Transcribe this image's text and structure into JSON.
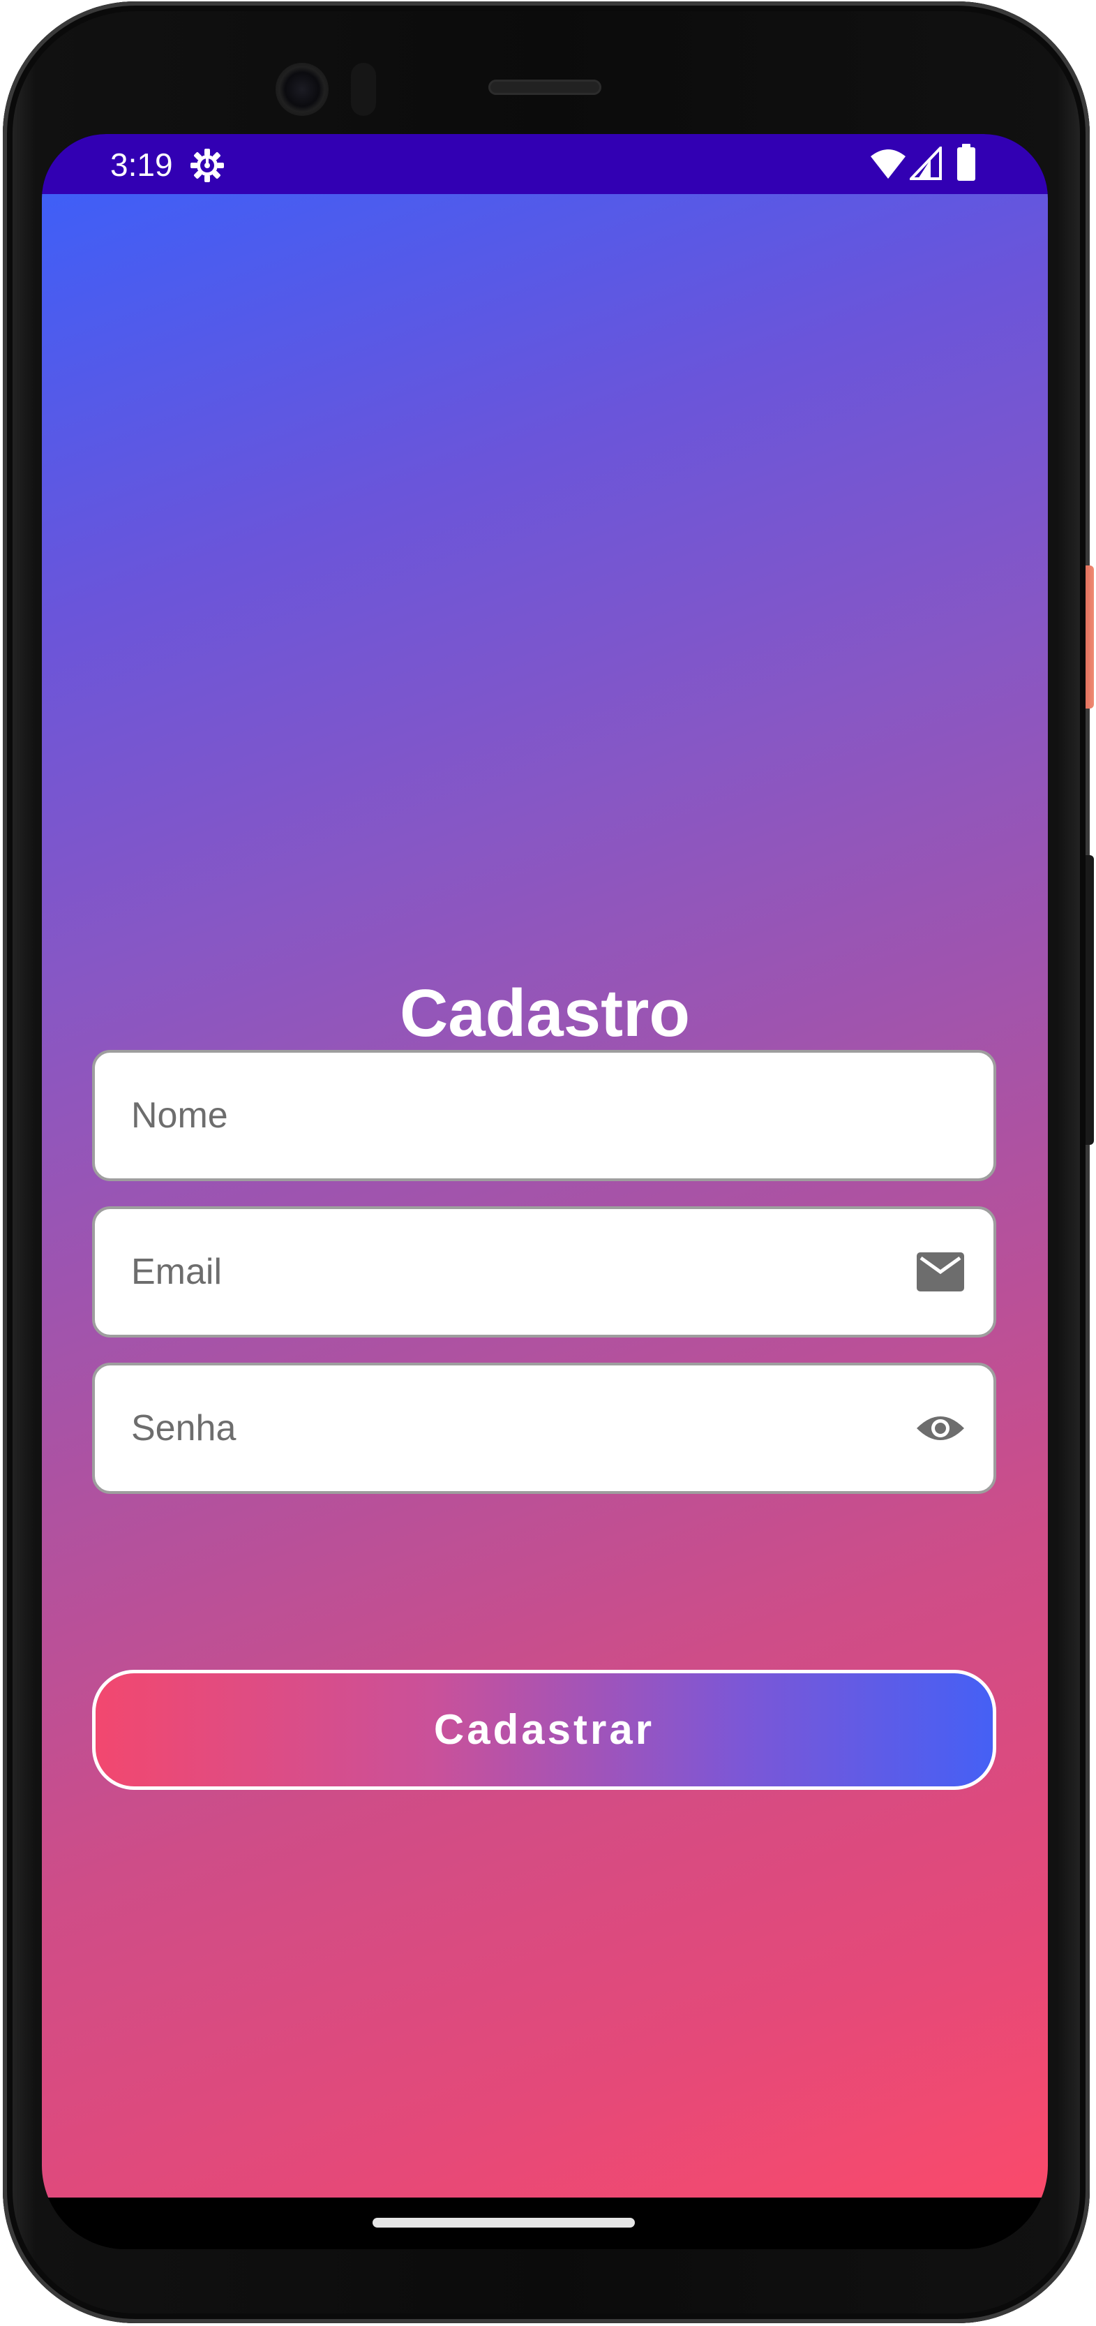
{
  "status_bar": {
    "time": "3:19",
    "background": "#3200b3",
    "icons": [
      "gear-icon",
      "wifi-icon",
      "signal-icon",
      "battery-icon"
    ]
  },
  "screen": {
    "title": "Cadastro",
    "gradient": [
      "#3f5ff7",
      "#8857c4",
      "#fa4a6b"
    ],
    "fields": {
      "name": {
        "placeholder": "Nome",
        "value": ""
      },
      "email": {
        "placeholder": "Email",
        "value": "",
        "icon": "mail-icon"
      },
      "password": {
        "placeholder": "Senha",
        "value": "",
        "icon": "eye-icon"
      }
    },
    "submit": {
      "label": "Cadastrar",
      "gradient": [
        "#f2486f",
        "#4560f5"
      ]
    }
  }
}
